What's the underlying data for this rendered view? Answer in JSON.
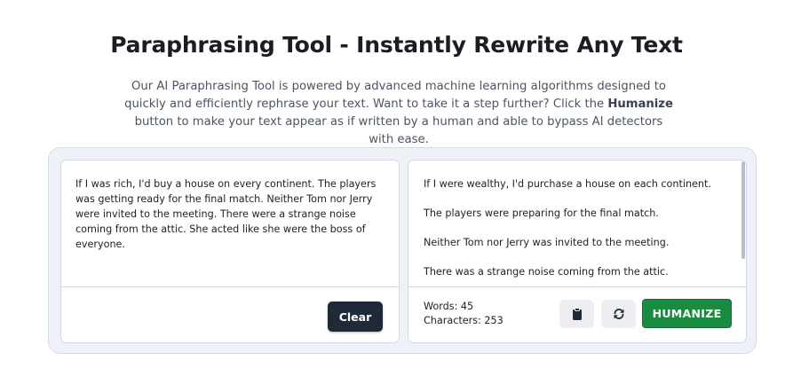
{
  "header": {
    "title": "Paraphrasing Tool - Instantly Rewrite Any Text",
    "description_part1": "Our AI Paraphrasing Tool is powered by advanced machine learning algorithms designed to quickly and efficiently rephrase your text. Want to take it a step further? Click the ",
    "description_bold": "Humanize",
    "description_part2": " button to make your text appear as if written by a human and able to bypass AI detectors with ease."
  },
  "input_panel": {
    "text": "If I was rich, I'd buy a house on every continent. The players was getting ready for the final match. Neither Tom nor Jerry were invited to the meeting. There were a strange noise coming from the attic. She acted like she were the boss of everyone.",
    "clear_label": "Clear"
  },
  "output_panel": {
    "sentences": [
      "If I were wealthy, I'd purchase a house on each continent.",
      "The players were preparing for the final match.",
      "Neither Tom nor Jerry was invited to the meeting.",
      "There was a strange noise coming from the attic."
    ],
    "words_label": "Words: 45",
    "characters_label": "Characters: 253",
    "copy_icon": "clipboard-icon",
    "refresh_icon": "refresh-icon",
    "humanize_label": "HUMANIZE"
  },
  "colors": {
    "humanize_green": "#1a8c3f",
    "clear_dark": "#1f2937",
    "panel_bg": "#eef2f8"
  }
}
